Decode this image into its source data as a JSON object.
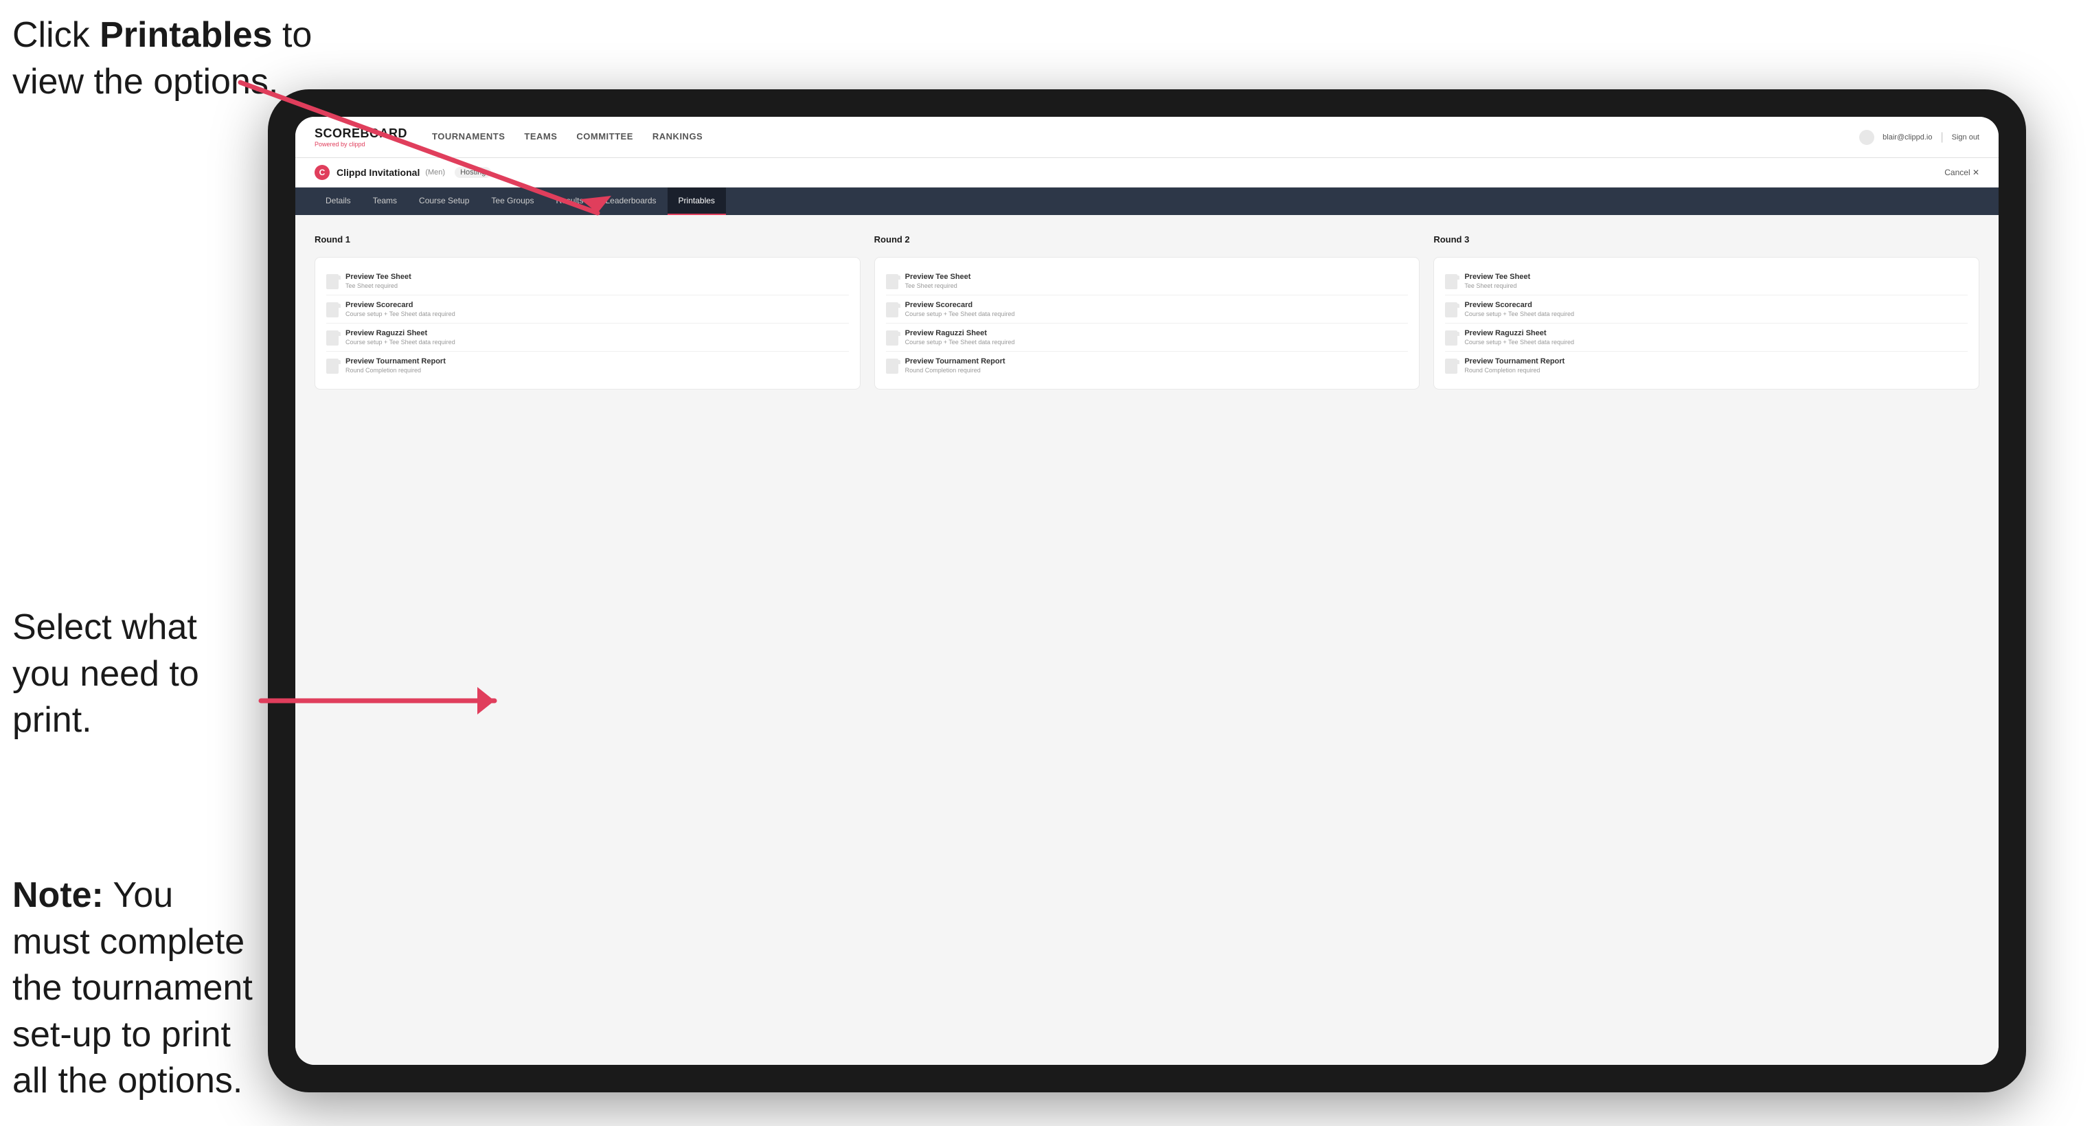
{
  "annotations": {
    "top_text_line1": "Click ",
    "top_text_bold": "Printables",
    "top_text_line2": " to",
    "top_text_line3": "view the options.",
    "middle_text": "Select what you need to print.",
    "bottom_text_bold": "Note:",
    "bottom_text": " You must complete the tournament set-up to print all the options."
  },
  "nav": {
    "brand": "SCOREBOARD",
    "brand_sub": "Powered by clippd",
    "items": [
      {
        "label": "TOURNAMENTS",
        "active": false
      },
      {
        "label": "TEAMS",
        "active": false
      },
      {
        "label": "COMMITTEE",
        "active": false
      },
      {
        "label": "RANKINGS",
        "active": false
      }
    ],
    "user_text": "blair@clippd.io",
    "sign_out": "Sign out"
  },
  "tournament": {
    "logo_letter": "C",
    "name": "Clippd Invitational",
    "tag": "(Men)",
    "status": "Hosting",
    "cancel": "Cancel ✕"
  },
  "sub_tabs": [
    {
      "label": "Details",
      "active": false
    },
    {
      "label": "Teams",
      "active": false
    },
    {
      "label": "Course Setup",
      "active": false
    },
    {
      "label": "Tee Groups",
      "active": false
    },
    {
      "label": "Results",
      "active": false
    },
    {
      "label": "Leaderboards",
      "active": false
    },
    {
      "label": "Printables",
      "active": true
    }
  ],
  "rounds": [
    {
      "title": "Round 1",
      "items": [
        {
          "title": "Preview Tee Sheet",
          "sub": "Tee Sheet required"
        },
        {
          "title": "Preview Scorecard",
          "sub": "Course setup + Tee Sheet data required"
        },
        {
          "title": "Preview Raguzzi Sheet",
          "sub": "Course setup + Tee Sheet data required"
        },
        {
          "title": "Preview Tournament Report",
          "sub": "Round Completion required"
        }
      ]
    },
    {
      "title": "Round 2",
      "items": [
        {
          "title": "Preview Tee Sheet",
          "sub": "Tee Sheet required"
        },
        {
          "title": "Preview Scorecard",
          "sub": "Course setup + Tee Sheet data required"
        },
        {
          "title": "Preview Raguzzi Sheet",
          "sub": "Course setup + Tee Sheet data required"
        },
        {
          "title": "Preview Tournament Report",
          "sub": "Round Completion required"
        }
      ]
    },
    {
      "title": "Round 3",
      "items": [
        {
          "title": "Preview Tee Sheet",
          "sub": "Tee Sheet required"
        },
        {
          "title": "Preview Scorecard",
          "sub": "Course setup + Tee Sheet data required"
        },
        {
          "title": "Preview Raguzzi Sheet",
          "sub": "Course setup + Tee Sheet data required"
        },
        {
          "title": "Preview Tournament Report",
          "sub": "Round Completion required"
        }
      ]
    }
  ]
}
